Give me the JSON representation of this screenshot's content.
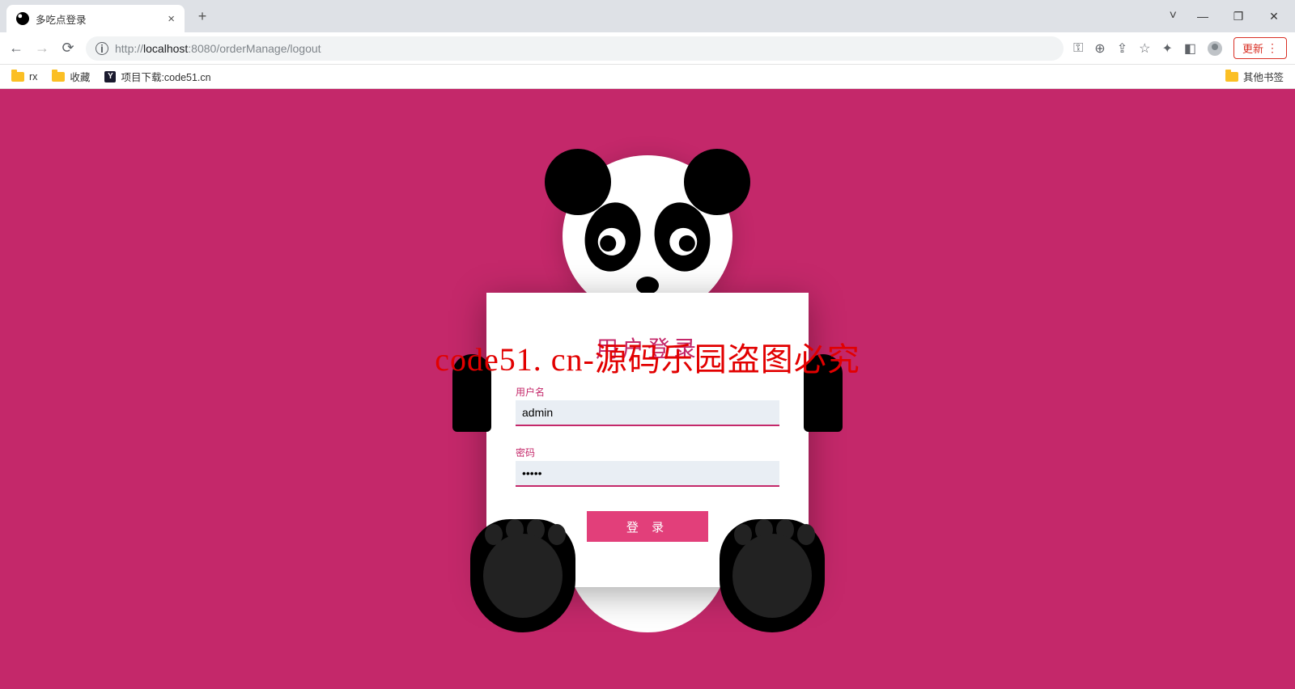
{
  "browser": {
    "tab_title": "多吃点登录",
    "url_host": "localhost",
    "url_port": ":8080",
    "url_path": "/orderManage/logout",
    "url_scheme": "http://",
    "update_label": "更新"
  },
  "bookmarks": {
    "items": [
      "rx",
      "收藏",
      "项目下载:code51.cn"
    ],
    "other": "其他书签"
  },
  "login": {
    "title": "用户登录",
    "username_label": "用户名",
    "username_value": "admin",
    "password_label": "密码",
    "password_value": "•••••",
    "button": "登 录"
  },
  "watermark": "code51. cn-源码乐园盗图必究"
}
